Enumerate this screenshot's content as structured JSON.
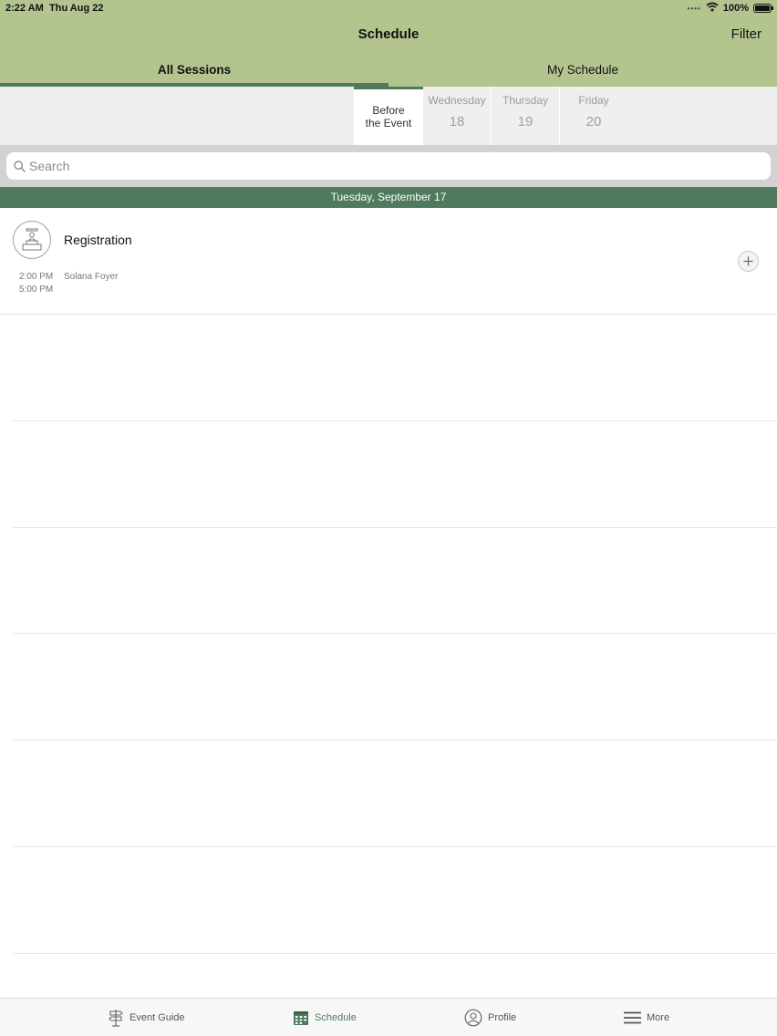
{
  "status_bar": {
    "time": "2:22 AM",
    "date": "Thu Aug 22",
    "battery": "100%"
  },
  "nav": {
    "title": "Schedule",
    "filter_label": "Filter"
  },
  "segments": [
    {
      "label": "All Sessions",
      "selected": true
    },
    {
      "label": "My Schedule",
      "selected": false
    }
  ],
  "days": [
    {
      "name": "Before\nthe Event",
      "number": "",
      "selected": true
    },
    {
      "name": "Wednesday",
      "number": "18",
      "selected": false
    },
    {
      "name": "Thursday",
      "number": "19",
      "selected": false
    },
    {
      "name": "Friday",
      "number": "20",
      "selected": false
    }
  ],
  "search": {
    "placeholder": "Search"
  },
  "date_header": "Tuesday, September 17",
  "sessions": [
    {
      "title": "Registration",
      "start": "2:00 PM",
      "end": "5:00 PM",
      "location": "Solana Foyer",
      "icon": "registration-desk-icon"
    }
  ],
  "tabbar": [
    {
      "label": "Event Guide",
      "icon": "signpost-icon",
      "active": false
    },
    {
      "label": "Schedule",
      "icon": "calendar-icon",
      "active": true
    },
    {
      "label": "Profile",
      "icon": "person-icon",
      "active": false
    },
    {
      "label": "More",
      "icon": "menu-icon",
      "active": false
    }
  ],
  "colors": {
    "header": "#b3c48f",
    "accent": "#4f7a5e"
  }
}
